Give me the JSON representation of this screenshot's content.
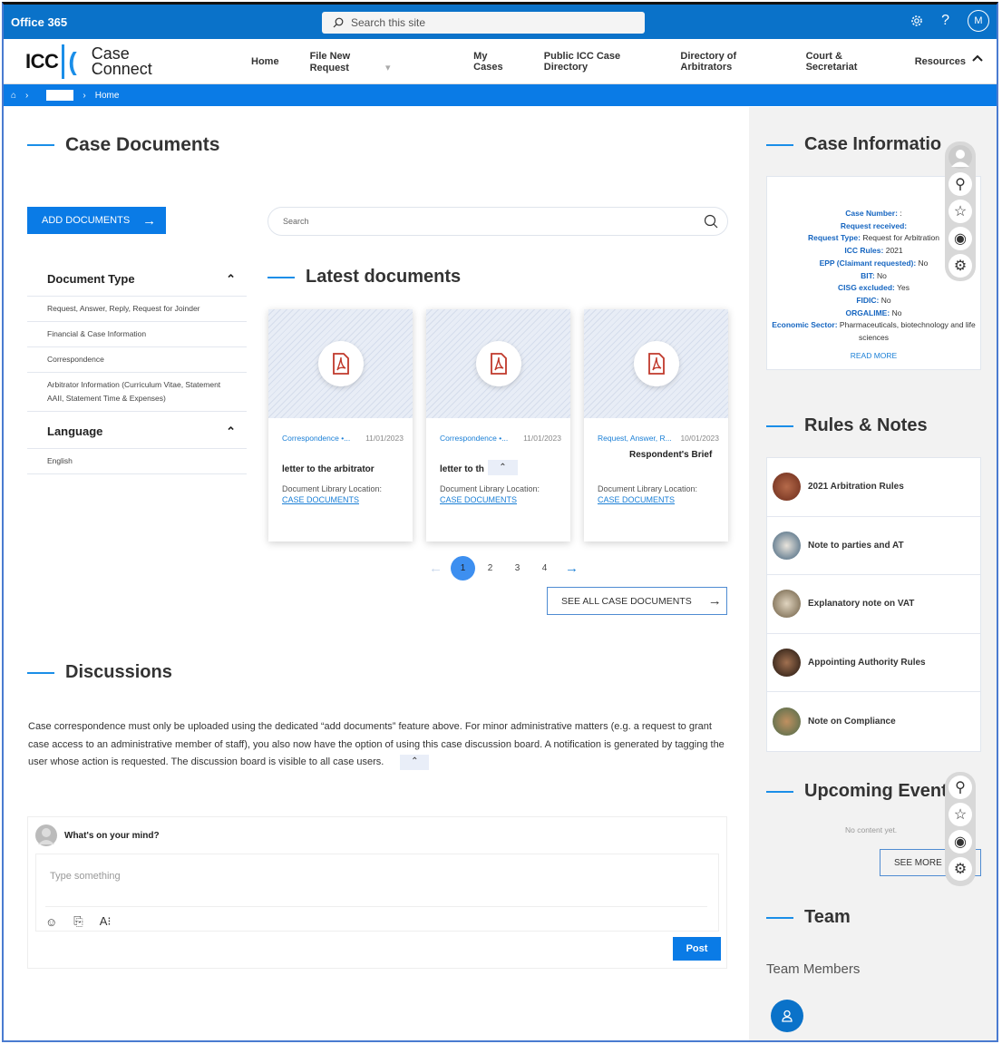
{
  "suite": {
    "brand": "Office 365",
    "search_placeholder": "Search this site",
    "avatar_initial": "M"
  },
  "nav": {
    "logo_text": "ICC",
    "logo_sub_1": "Case",
    "logo_sub_2": "Connect",
    "items": [
      "Home",
      "File New Request",
      "My Cases",
      "Public ICC Case Directory",
      "Directory of Arbitrators",
      "Court & Secretariat",
      "Resources"
    ]
  },
  "breadcrumb": {
    "current": "Home"
  },
  "case_documents": {
    "title": "Case Documents",
    "add_button": "ADD DOCUMENTS",
    "search_placeholder": "Search",
    "filters": [
      {
        "heading": "Document Type",
        "items": [
          "Request, Answer, Reply, Request for Joinder",
          "Financial & Case Information",
          "Correspondence",
          "Arbitrator Information (Curriculum Vitae, Statement AAII, Statement Time & Expenses)"
        ]
      },
      {
        "heading": "Language",
        "items": [
          "English"
        ]
      }
    ],
    "latest_title": "Latest documents",
    "cards": [
      {
        "category": "Correspondence •...",
        "date": "11/01/2023",
        "title": "letter to the arbitrator",
        "location_label": "Document Library Location:",
        "location_link": "CASE DOCUMENTS"
      },
      {
        "category": "Correspondence •...",
        "date": "11/01/2023",
        "title": "letter to th      es",
        "location_label": "Document Library Location:",
        "location_link": "CASE DOCUMENTS"
      },
      {
        "category": "Request, Answer, R...",
        "date": "10/01/2023",
        "title": "Respondent's Brief",
        "location_label": "Document Library Location:",
        "location_link": "CASE DOCUMENTS"
      }
    ],
    "pages": [
      "1",
      "2",
      "3",
      "4"
    ],
    "current_page": "1",
    "see_all": "SEE ALL CASE DOCUMENTS"
  },
  "discussions": {
    "title": "Discussions",
    "notice": "Case correspondence must only be uploaded using the dedicated “add documents” feature above. For minor administrative matters (e.g. a request to grant case access to an administrative member of staff), you also now have the option of using this case discussion board. A notification is generated by tagging the user whose action is requested. The discussion board is visible to all case users.",
    "prompt": "What's on your mind?",
    "input_placeholder": "Type something",
    "post_button": "Post"
  },
  "case_information": {
    "title": "Case Informatio",
    "fields": [
      {
        "label": "Case Number:",
        "value": ":"
      },
      {
        "label": "Request received:",
        "value": ""
      },
      {
        "label": "Request Type:",
        "value": "Request for Arbitration"
      },
      {
        "label": "ICC Rules:",
        "value": "2021"
      },
      {
        "label": "EPP (Claimant requested):",
        "value": "No"
      },
      {
        "label": "BIT:",
        "value": "No"
      },
      {
        "label": "CISG excluded:",
        "value": "Yes"
      },
      {
        "label": "FIDIC:",
        "value": "No"
      },
      {
        "label": "ORGALIME:",
        "value": "No"
      },
      {
        "label": "Economic Sector:",
        "value": "Pharmaceuticals, biotechnology and life sciences"
      }
    ],
    "read_more": "READ MORE"
  },
  "rules_notes": {
    "title": "Rules & Notes",
    "items": [
      {
        "label": "2021 Arbitration Rules",
        "color": "#8a3b2b"
      },
      {
        "label": "Note to parties and AT",
        "color": "#3d5f7a"
      },
      {
        "label": "Explanatory note on VAT",
        "color": "#a08a6a"
      },
      {
        "label": "Appointing Authority Rules",
        "color": "#3a2a1e"
      },
      {
        "label": "Note on Compliance",
        "color": "#6b4a3a"
      }
    ]
  },
  "upcoming_events": {
    "title": "Upcoming Events",
    "empty": "No content yet.",
    "see_more": "SEE MORE"
  },
  "team": {
    "title": "Team",
    "subtitle": "Team Members"
  },
  "colors": {
    "primary": "#0a7be6",
    "suite": "#0a72c9",
    "accent_line": "#1a8ee8",
    "link": "#1a7fd6"
  }
}
